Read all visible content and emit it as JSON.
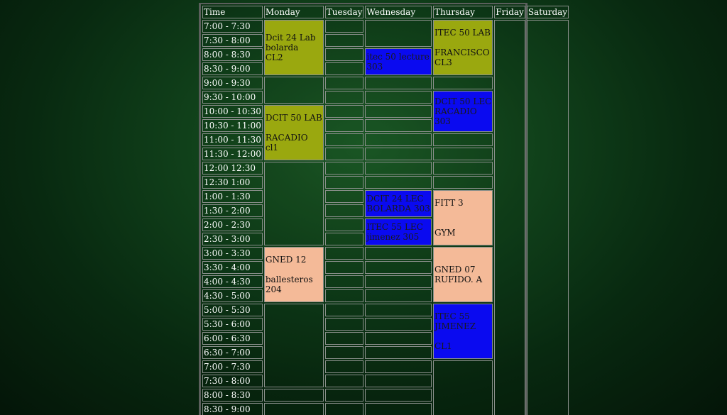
{
  "header": [
    "Time",
    "Monday",
    "Tuesday",
    "Wednesday",
    "Thursday",
    "Friday",
    "Saturday"
  ],
  "times": [
    "7:00 - 7:30",
    "7:30 - 8:00",
    "8:00 - 8:30",
    "8:30 - 9:00",
    "9:00 - 9:30",
    "9:30 - 10:00",
    "10:00 - 10:30",
    "10:30 - 11:00",
    "11:00 - 11:30",
    "11:30 - 12:00",
    "12:00 12:30",
    "12:30 1:00",
    "1:00 - 1:30",
    "1:30 - 2:00",
    "2:00 - 2:30",
    "2:30 - 3:00",
    "3:00 - 3:30",
    "3:30 - 4:00",
    "4:00 - 4:30",
    "4:30 - 5:00",
    "5:00 - 5:30",
    "5:30 - 6:00",
    "6:00 - 6:30",
    "6:30 - 7:00",
    "7:00 - 7:30",
    "7:30 - 8:00",
    "8:00 - 8:30",
    "8:30 - 9:00"
  ],
  "events": {
    "mon1": [
      "Dcit 24 Lab",
      "bolarda",
      "CL2"
    ],
    "mon2": [
      "DCIT 50 LAB",
      "RACADIO",
      "cl1"
    ],
    "mon3": [
      "GNED 12",
      "ballesteros",
      "204"
    ],
    "wed1": [
      "itec 50 lecture",
      "303"
    ],
    "wed2": [
      "DCIT 24 LEC",
      "BOLARDA 303"
    ],
    "wed3": [
      "ITEC 55 LEC",
      "jimenez 305"
    ],
    "thu1": [
      "ITEC 50 LAB",
      "FRANCISCO",
      "CL3"
    ],
    "thu2": [
      "DCIT 50 LEC",
      "RACADIO",
      "303"
    ],
    "thu3": [
      "FITT 3",
      "GYM"
    ],
    "thu4": [
      "GNED 07",
      "RUFIDO. A"
    ],
    "thu5": [
      "ITEC 55",
      "JIMENEZ",
      "CL1"
    ]
  },
  "colors": {
    "olive": "#9aa80f",
    "blue": "#0a0af0",
    "peach": "#f4ba98"
  }
}
